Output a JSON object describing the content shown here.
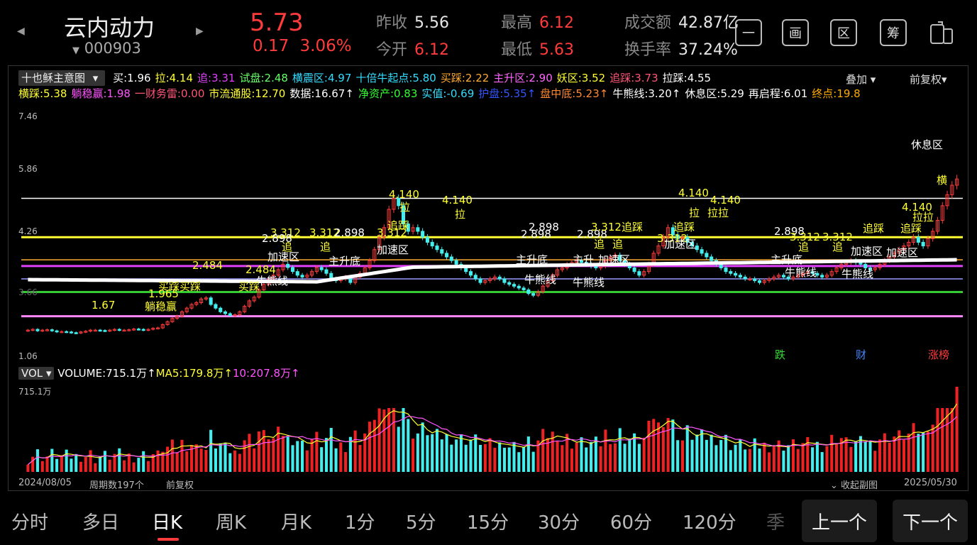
{
  "header": {
    "name": "云内动力",
    "code": "000903",
    "price": "5.73",
    "change": "0.17",
    "change_pct": "3.06%",
    "stats": {
      "prev_close_label": "昨收",
      "prev_close": "5.56",
      "open_label": "今开",
      "open": "6.12",
      "high_label": "最高",
      "high": "6.12",
      "low_label": "最低",
      "low": "5.63",
      "amount_label": "成交额",
      "amount": "42.87亿",
      "turnover_label": "换手率",
      "turnover": "37.24%"
    },
    "tools": [
      "一",
      "画",
      "区",
      "筹"
    ]
  },
  "indicator": {
    "name": "十也稣主意图",
    "row1": [
      {
        "t": "买:1.96",
        "c": "#ffffff"
      },
      {
        "t": "拉:4.14",
        "c": "#ffff33"
      },
      {
        "t": "追:3.31",
        "c": "#e040fb"
      },
      {
        "t": "试盘:2.48",
        "c": "#66ff66"
      },
      {
        "t": "横震区:4.97",
        "c": "#33ddff"
      },
      {
        "t": "十倍牛起点:5.80",
        "c": "#33ddff"
      },
      {
        "t": "买踩:2.22",
        "c": "#ffaa33"
      },
      {
        "t": "主升区:2.90",
        "c": "#ff66ff"
      },
      {
        "t": "妖区:3.52",
        "c": "#ffff33"
      },
      {
        "t": "追踩:3.73",
        "c": "#ff5577"
      },
      {
        "t": "拉踩:4.55",
        "c": "#ffffff"
      }
    ],
    "row2": [
      {
        "t": "横踩:5.38",
        "c": "#ffff33"
      },
      {
        "t": "躺稳赢:1.98",
        "c": "#ff55ff"
      },
      {
        "t": "一财务雷:0.00",
        "c": "#ff5577"
      },
      {
        "t": "市流通股:12.70",
        "c": "#ffff33"
      },
      {
        "t": "数据:16.67↑",
        "c": "#ffffff"
      },
      {
        "t": "净资产:0.83",
        "c": "#33ff33"
      },
      {
        "t": "实值:-0.69",
        "c": "#33ddff"
      },
      {
        "t": "护盘:5.35↑",
        "c": "#3355ff"
      },
      {
        "t": "盘中底:5.23↑",
        "c": "#ff8833"
      },
      {
        "t": "牛熊线:3.20↑",
        "c": "#ffffff"
      },
      {
        "t": "休息区:5.29",
        "c": "#ffffff"
      },
      {
        "t": "再启程:6.01",
        "c": "#ffffff"
      },
      {
        "t": "终点:19.8",
        "c": "#ffaa00"
      }
    ],
    "overlay": "叠加",
    "adjust": "前复权"
  },
  "chart": {
    "y_ticks": [
      "7.46",
      "5.86",
      "4.26",
      "3.66",
      "1.06"
    ],
    "chart_data": {
      "type": "candlestick",
      "x_range": [
        "2024/08/05",
        "2025/05/30"
      ],
      "ylim": [
        1.06,
        7.46
      ],
      "close": [
        1.6,
        1.62,
        1.58,
        1.6,
        1.61,
        1.58,
        1.55,
        1.56,
        1.55,
        1.53,
        1.52,
        1.55,
        1.57,
        1.6,
        1.6,
        1.59,
        1.58,
        1.6,
        1.62,
        1.6,
        1.6,
        1.61,
        1.63,
        1.62,
        1.6,
        1.62,
        1.65,
        1.66,
        1.75,
        1.83,
        1.92,
        1.98,
        2.1,
        2.2,
        2.3,
        2.35,
        2.45,
        2.48,
        2.3,
        2.2,
        2.1,
        2.05,
        2.0,
        2.02,
        2.1,
        2.25,
        2.4,
        2.5,
        2.7,
        2.85,
        3.0,
        3.1,
        3.25,
        3.4,
        3.31,
        3.2,
        3.1,
        3.05,
        3.1,
        3.2,
        3.31,
        3.25,
        3.15,
        3.0,
        2.95,
        3.0,
        3.05,
        2.9,
        3.05,
        3.15,
        3.3,
        3.5,
        3.8,
        4.14,
        4.4,
        4.9,
        5.2,
        5.0,
        4.5,
        4.3,
        4.4,
        4.3,
        4.14,
        4.0,
        3.9,
        3.8,
        3.7,
        3.6,
        3.5,
        3.4,
        3.3,
        3.2,
        3.1,
        3.0,
        2.9,
        2.95,
        3.0,
        3.05,
        3.0,
        2.9,
        2.85,
        2.8,
        2.75,
        2.7,
        2.6,
        2.55,
        2.65,
        2.8,
        2.95,
        3.1,
        3.25,
        3.3,
        3.4,
        3.45,
        3.5,
        3.45,
        3.4,
        3.35,
        3.3,
        3.35,
        3.5,
        3.6,
        3.65,
        3.5,
        3.4,
        3.3,
        3.2,
        3.1,
        3.2,
        3.4,
        3.7,
        3.9,
        4.14,
        4.4,
        4.2,
        4.1,
        4.14,
        4.0,
        3.9,
        3.8,
        3.7,
        3.6,
        3.5,
        3.4,
        3.3,
        3.2,
        3.15,
        3.1,
        3.05,
        3.0,
        3.0,
        2.95,
        2.9,
        2.95,
        3.0,
        3.05,
        3.1,
        3.05,
        3.0,
        3.05,
        3.1,
        3.15,
        3.2,
        3.15,
        3.1,
        3.05,
        3.1,
        3.2,
        3.3,
        3.4,
        3.45,
        3.5,
        3.45,
        3.4,
        3.3,
        3.25,
        3.3,
        3.4,
        3.5,
        3.6,
        3.7,
        3.8,
        3.9,
        4.0,
        4.14,
        4.0,
        3.9,
        4.1,
        4.3,
        4.6,
        5.0,
        5.3,
        5.56,
        5.73
      ],
      "volume_max": "715.1万"
    },
    "labels": [
      {
        "t": "休息区",
        "x": 1283,
        "y": 194,
        "c": "#ffffff"
      },
      {
        "t": "横",
        "x": 1319,
        "y": 244,
        "c": "#ffff33"
      },
      {
        "t": "4.140",
        "x": 547,
        "y": 264,
        "c": "#ffff33"
      },
      {
        "t": "4.140",
        "x": 622,
        "y": 272,
        "c": "#ffff33"
      },
      {
        "t": "拉",
        "x": 562,
        "y": 282,
        "c": "#ffff33"
      },
      {
        "t": "拉",
        "x": 640,
        "y": 292,
        "c": "#ffff33"
      },
      {
        "t": "追踩",
        "x": 545,
        "y": 308,
        "c": "#ffff33"
      },
      {
        "t": "3.312",
        "x": 380,
        "y": 318,
        "c": "#ffff33"
      },
      {
        "t": "3.312",
        "x": 435,
        "y": 318,
        "c": "#ffff33"
      },
      {
        "t": "2.898",
        "x": 470,
        "y": 318,
        "c": "#ffffff"
      },
      {
        "t": "3.312",
        "x": 530,
        "y": 318,
        "c": "#ffff33"
      },
      {
        "t": "2.898",
        "x": 368,
        "y": 326,
        "c": "#ffffff"
      },
      {
        "t": "追",
        "x": 396,
        "y": 338,
        "c": "#ffff33"
      },
      {
        "t": "追",
        "x": 450,
        "y": 338,
        "c": "#ffff33"
      },
      {
        "t": "加速区",
        "x": 530,
        "y": 342,
        "c": "#ffffff"
      },
      {
        "t": "加速区",
        "x": 376,
        "y": 352,
        "c": "#ffffff"
      },
      {
        "t": "主升底",
        "x": 462,
        "y": 358,
        "c": "#ffffff"
      },
      {
        "t": "2.484",
        "x": 270,
        "y": 364,
        "c": "#ffff33"
      },
      {
        "t": "2.484",
        "x": 345,
        "y": 370,
        "c": "#ffff33"
      },
      {
        "t": "牛熊线",
        "x": 360,
        "y": 386,
        "c": "#ffffff"
      },
      {
        "t": "买踩买踩",
        "x": 222,
        "y": 394,
        "c": "#ffff33"
      },
      {
        "t": "买踩",
        "x": 335,
        "y": 394,
        "c": "#ffff33"
      },
      {
        "t": "1.965",
        "x": 208,
        "y": 404,
        "c": "#ffff33"
      },
      {
        "t": "1.67",
        "x": 128,
        "y": 420,
        "c": "#ffff33"
      },
      {
        "t": "躺稳赢",
        "x": 203,
        "y": 422,
        "c": "#ffff33"
      },
      {
        "t": "2.898",
        "x": 744,
        "y": 310,
        "c": "#ffffff"
      },
      {
        "t": "2.898",
        "x": 733,
        "y": 320,
        "c": "#ffffff"
      },
      {
        "t": "2.898",
        "x": 812,
        "y": 320,
        "c": "#ffffff"
      },
      {
        "t": "3.312追踩",
        "x": 832,
        "y": 310,
        "c": "#ffff33"
      },
      {
        "t": "追",
        "x": 836,
        "y": 334,
        "c": "#ffff33"
      },
      {
        "t": "追",
        "x": 862,
        "y": 334,
        "c": "#ffff33"
      },
      {
        "t": "主升底",
        "x": 726,
        "y": 356,
        "c": "#ffffff"
      },
      {
        "t": "主升",
        "x": 806,
        "y": 356,
        "c": "#ffffff"
      },
      {
        "t": "加速区",
        "x": 842,
        "y": 356,
        "c": "#ffffff"
      },
      {
        "t": "牛熊线",
        "x": 738,
        "y": 384,
        "c": "#ffffff"
      },
      {
        "t": "牛熊线",
        "x": 806,
        "y": 388,
        "c": "#ffffff"
      },
      {
        "t": "4.140",
        "x": 955,
        "y": 262,
        "c": "#ffff33"
      },
      {
        "t": "4.140",
        "x": 1000,
        "y": 272,
        "c": "#ffff33"
      },
      {
        "t": "拉",
        "x": 970,
        "y": 290,
        "c": "#ffff33"
      },
      {
        "t": "拉拉",
        "x": 996,
        "y": 290,
        "c": "#ffff33"
      },
      {
        "t": "追踩",
        "x": 948,
        "y": 310,
        "c": "#ffff33"
      },
      {
        "t": "3.312",
        "x": 925,
        "y": 326,
        "c": "#ffff33"
      },
      {
        "t": "加速区",
        "x": 935,
        "y": 334,
        "c": "#ffffff"
      },
      {
        "t": "2.898",
        "x": 1090,
        "y": 316,
        "c": "#ffffff"
      },
      {
        "t": "3.312",
        "x": 1112,
        "y": 324,
        "c": "#ffff33"
      },
      {
        "t": "3.312",
        "x": 1158,
        "y": 324,
        "c": "#ffff33"
      },
      {
        "t": "追",
        "x": 1124,
        "y": 338,
        "c": "#ffff33"
      },
      {
        "t": "追",
        "x": 1172,
        "y": 338,
        "c": "#ffff33"
      },
      {
        "t": "追踩",
        "x": 1215,
        "y": 312,
        "c": "#ffff33"
      },
      {
        "t": "追踩",
        "x": 1268,
        "y": 312,
        "c": "#ffff33"
      },
      {
        "t": "加速区",
        "x": 1198,
        "y": 344,
        "c": "#ffffff"
      },
      {
        "t": "加速区",
        "x": 1248,
        "y": 346,
        "c": "#ffffff"
      },
      {
        "t": "主升底",
        "x": 1085,
        "y": 356,
        "c": "#ffffff"
      },
      {
        "t": "牛熊线",
        "x": 1105,
        "y": 374,
        "c": "#ffffff"
      },
      {
        "t": "牛熊线",
        "x": 1185,
        "y": 376,
        "c": "#ffffff"
      },
      {
        "t": "4.140",
        "x": 1270,
        "y": 282,
        "c": "#ffff33"
      },
      {
        "t": "拉拉",
        "x": 1285,
        "y": 296,
        "c": "#ffff33"
      }
    ],
    "tags": {
      "fall": "跌",
      "finance": "财",
      "rise": "涨榜"
    }
  },
  "volume": {
    "name": "VOL",
    "items": [
      {
        "t": "VOLUME:715.1万↑",
        "c": "#ffffff"
      },
      {
        "t": "MA5:179.8万↑",
        "c": "#ffff33"
      },
      {
        "t": "10:207.8万↑",
        "c": "#ff55ff"
      }
    ],
    "max_label": "715.1万"
  },
  "bottom": {
    "start_date": "2024/08/05",
    "periods_count": "周期数197个",
    "adjust": "前复权",
    "collapse": "收起副图",
    "end_date": "2025/05/30"
  },
  "periods": [
    "分时",
    "多日",
    "日K",
    "周K",
    "月K",
    "1分",
    "5分",
    "15分",
    "30分",
    "60分",
    "120分",
    "季"
  ],
  "active_period": 2,
  "nav": {
    "prev": "上一个",
    "next": "下一个"
  }
}
